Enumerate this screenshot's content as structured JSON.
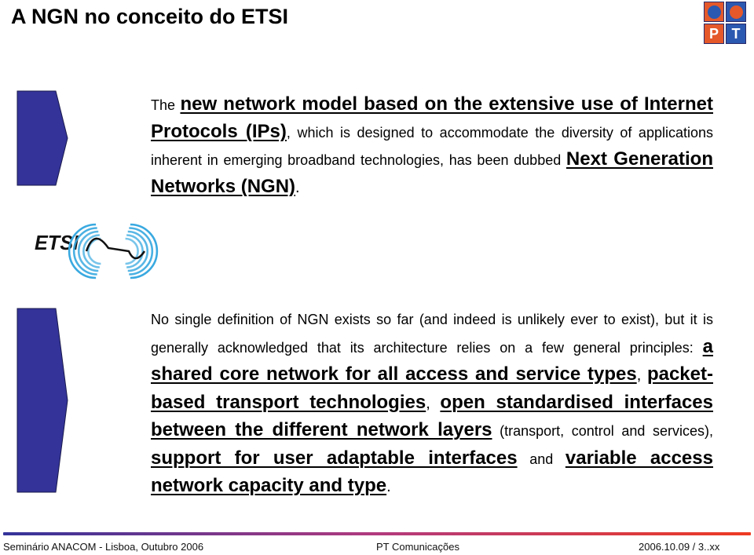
{
  "slide": {
    "title": "A NGN no conceito do ETSI"
  },
  "logo_pt": {
    "letters": [
      "P",
      "T"
    ],
    "colors": {
      "orange": "#e4582a",
      "blue": "#2b58b0"
    }
  },
  "paragraph1": {
    "segments": [
      {
        "text": "The ",
        "style": "sm"
      },
      {
        "text": "new network model based on the extensive use of Internet Protocols (IPs)",
        "style": "lg"
      },
      {
        "text": ", which is designed to accommodate the diversity of applications inherent in emerging broadband technologies, has been dubbed ",
        "style": "sm"
      },
      {
        "text": "Next Generation Networks (NGN)",
        "style": "lg"
      },
      {
        "text": ".",
        "style": "md"
      }
    ]
  },
  "etsi_logo": {
    "text": "ETSI",
    "ring_color": "#39a9e0"
  },
  "paragraph2": {
    "segments": [
      {
        "text": "No single definition of NGN exists so far (and indeed is unlikely ever to exist), but it is generally acknowledged that its architecture relies on a few general principles: ",
        "style": "sm"
      },
      {
        "text": "a shared core network for all access and service types",
        "style": "lg"
      },
      {
        "text": ", ",
        "style": "md"
      },
      {
        "text": "packet-based transport technologies",
        "style": "lg"
      },
      {
        "text": ", ",
        "style": "md"
      },
      {
        "text": "open standardised interfaces between the different network layers",
        "style": "lg"
      },
      {
        "text": " (transport, control and services), ",
        "style": "sm"
      },
      {
        "text": "support for user adaptable interfaces",
        "style": "lg"
      },
      {
        "text": " and ",
        "style": "sm"
      },
      {
        "text": "variable access network capacity and type",
        "style": "lg"
      },
      {
        "text": ".",
        "style": "md"
      }
    ]
  },
  "arrows": {
    "fill": "#333399",
    "stroke": "#1a1a4d"
  },
  "footer": {
    "left": "Seminário ANACOM - Lisboa, Outubro 2006",
    "center": "PT Comunicações",
    "right": "2006.10.09 / 3..xx",
    "bar_gradient": [
      "#33339a",
      "#b23a7e",
      "#ee3a22"
    ]
  }
}
